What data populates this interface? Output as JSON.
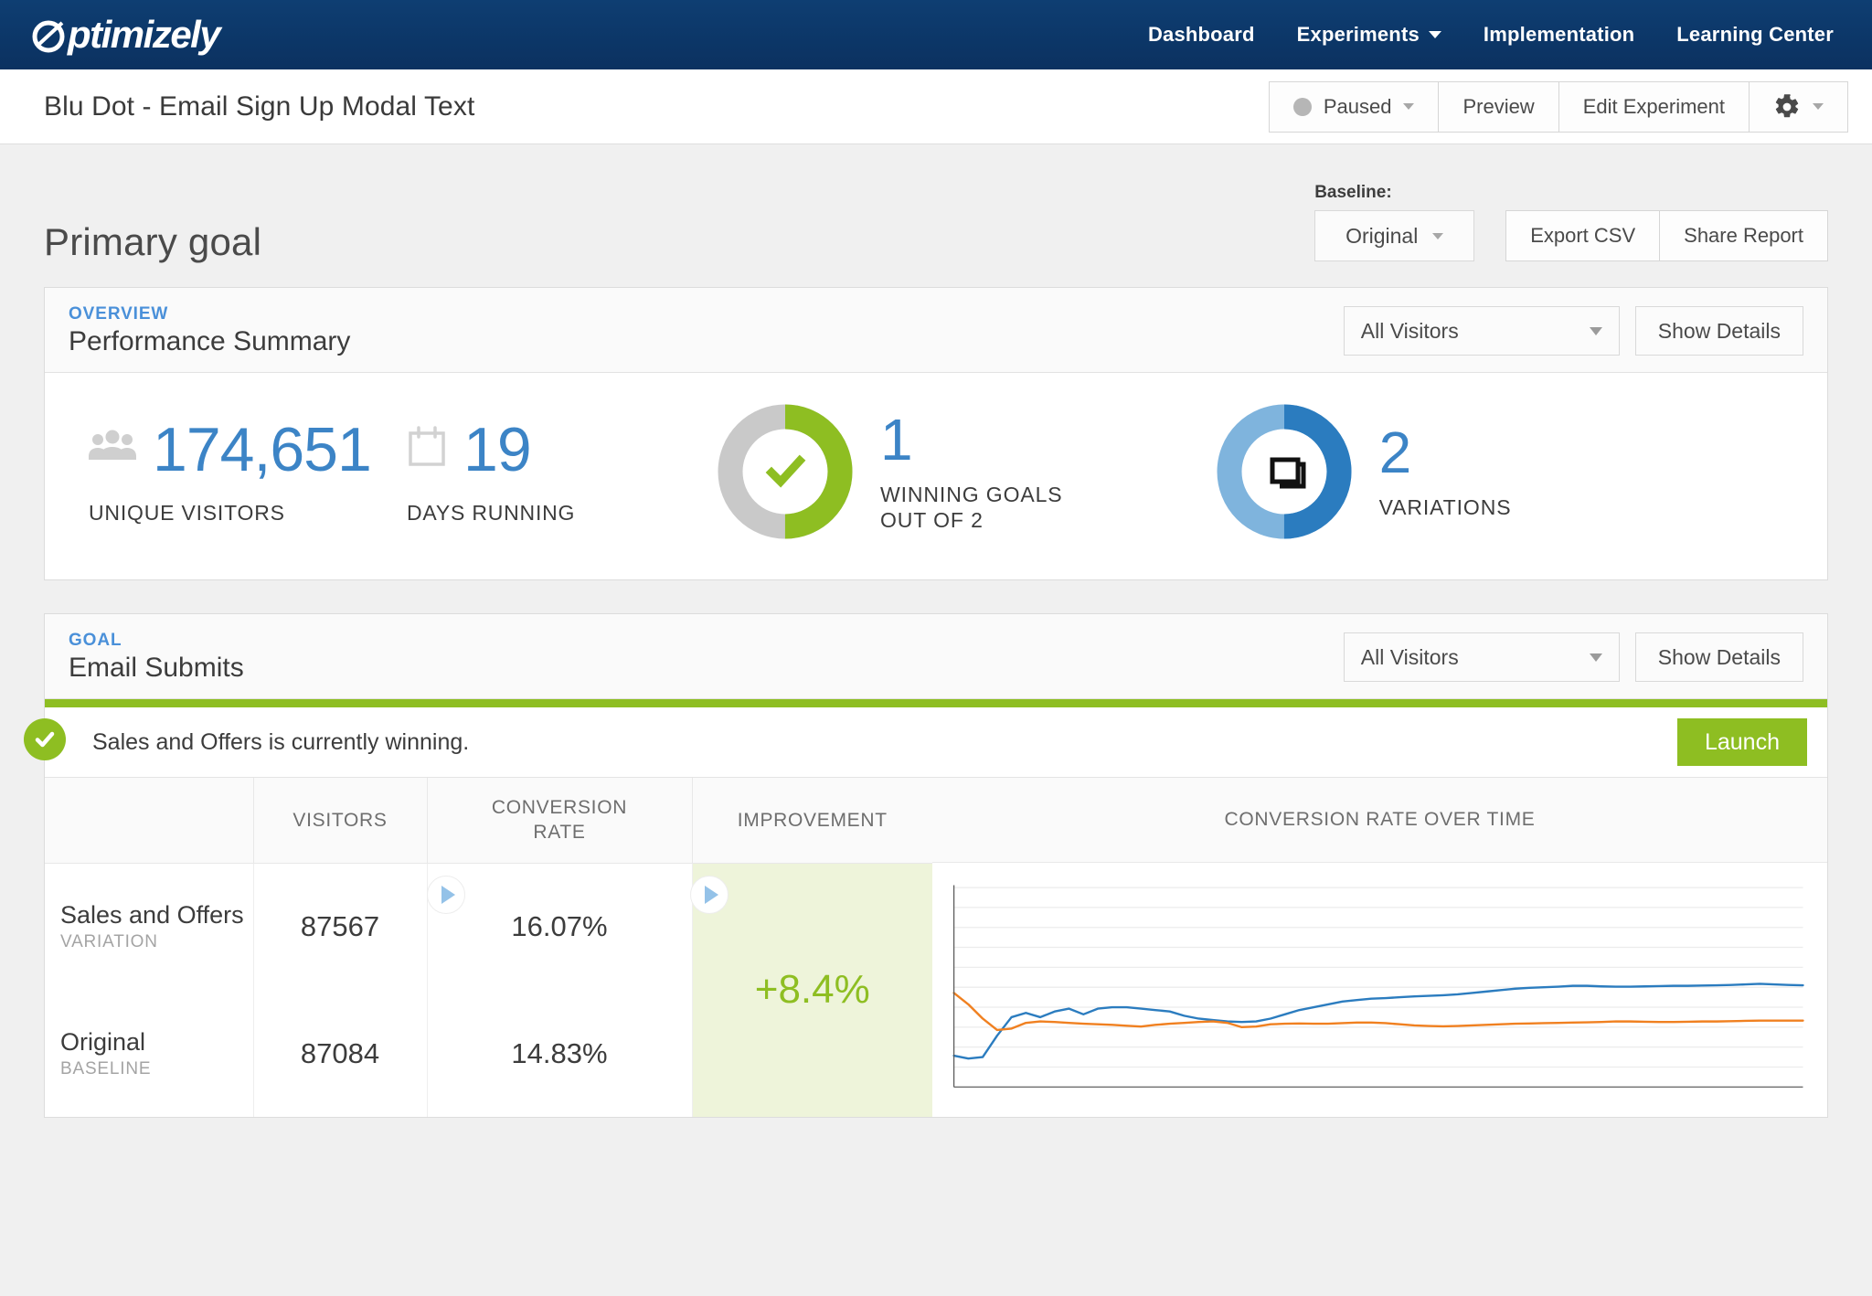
{
  "brand": {
    "logo_text": "ptimizely",
    "nav_bg": "#0d3c6e",
    "accent_blue": "#3c84c6",
    "accent_green": "#8ebe22"
  },
  "topnav": {
    "items": [
      {
        "label": "Dashboard",
        "has_caret": false
      },
      {
        "label": "Experiments",
        "has_caret": true
      },
      {
        "label": "Implementation",
        "has_caret": false
      },
      {
        "label": "Learning Center",
        "has_caret": false
      }
    ]
  },
  "titlebar": {
    "experiment_name": "Blu Dot - Email Sign Up Modal Text",
    "status_label": "Paused",
    "preview_label": "Preview",
    "edit_label": "Edit Experiment"
  },
  "page": {
    "title": "Primary goal",
    "baseline_label": "Baseline:",
    "baseline_value": "Original",
    "export_label": "Export CSV",
    "share_label": "Share Report"
  },
  "overview": {
    "kicker": "OVERVIEW",
    "title": "Performance Summary",
    "filter_value": "All Visitors",
    "details_label": "Show Details",
    "stats": {
      "unique_visitors_value": "174,651",
      "unique_visitors_label": "UNIQUE VISITORS",
      "days_running_value": "19",
      "days_running_label": "DAYS RUNNING",
      "winning_goals_value": "1",
      "winning_goals_label_line1": "WINNING GOALS",
      "winning_goals_label_line2": "OUT OF 2",
      "variations_value": "2",
      "variations_label": "VARIATIONS"
    }
  },
  "goal": {
    "kicker": "GOAL",
    "title": "Email Submits",
    "filter_value": "All Visitors",
    "details_label": "Show Details",
    "winning_message": "Sales and Offers is currently winning.",
    "launch_label": "Launch",
    "columns": {
      "name": "",
      "visitors": "VISITORS",
      "rate_line1": "CONVERSION",
      "rate_line2": "RATE",
      "improvement": "IMPROVEMENT",
      "chart": "CONVERSION RATE OVER TIME"
    },
    "rows": [
      {
        "name": "Sales and Offers",
        "type": "VARIATION",
        "visitors": "87567",
        "conversion_rate": "16.07%",
        "improvement": "+8.4%"
      },
      {
        "name": "Original",
        "type": "BASELINE",
        "visitors": "87084",
        "conversion_rate": "14.83%",
        "improvement": ""
      }
    ]
  },
  "chart_data": {
    "type": "line",
    "title": "CONVERSION RATE OVER TIME",
    "xlabel": "",
    "ylabel": "",
    "ylim": [
      12.5,
      19.5
    ],
    "grid": true,
    "legend": "none",
    "x": [
      0,
      1,
      2,
      3,
      4,
      5,
      6,
      7,
      8,
      9,
      10,
      11,
      12,
      13,
      14,
      15,
      16,
      17,
      18,
      19,
      20,
      21,
      22,
      23,
      24,
      25,
      26,
      27,
      28,
      29,
      30,
      31,
      32,
      33,
      34,
      35,
      36,
      37,
      38,
      39,
      40,
      41,
      42,
      43,
      44,
      45,
      46,
      47,
      48,
      49,
      50,
      51,
      52,
      53,
      54,
      55,
      56,
      57,
      58,
      59
    ],
    "series": [
      {
        "name": "Sales and Offers",
        "color": "#2b7cbf",
        "values": [
          13.6,
          13.5,
          13.55,
          14.3,
          14.95,
          15.1,
          14.95,
          15.15,
          15.25,
          15.05,
          15.25,
          15.3,
          15.3,
          15.25,
          15.2,
          15.15,
          15.0,
          14.9,
          14.85,
          14.8,
          14.78,
          14.8,
          14.9,
          15.05,
          15.2,
          15.3,
          15.4,
          15.5,
          15.55,
          15.6,
          15.62,
          15.65,
          15.68,
          15.7,
          15.72,
          15.75,
          15.8,
          15.85,
          15.9,
          15.95,
          15.98,
          16.0,
          16.02,
          16.05,
          16.05,
          16.03,
          16.02,
          16.02,
          16.03,
          16.04,
          16.05,
          16.05,
          16.06,
          16.07,
          16.08,
          16.1,
          16.12,
          16.1,
          16.08,
          16.07
        ]
      },
      {
        "name": "Original",
        "color": "#f08020",
        "values": [
          15.8,
          15.4,
          14.9,
          14.5,
          14.55,
          14.75,
          14.8,
          14.78,
          14.75,
          14.72,
          14.7,
          14.68,
          14.65,
          14.62,
          14.68,
          14.72,
          14.75,
          14.78,
          14.8,
          14.75,
          14.6,
          14.62,
          14.7,
          14.72,
          14.73,
          14.72,
          14.72,
          14.74,
          14.76,
          14.76,
          14.74,
          14.7,
          14.66,
          14.64,
          14.63,
          14.64,
          14.66,
          14.68,
          14.7,
          14.72,
          14.73,
          14.74,
          14.75,
          14.76,
          14.77,
          14.78,
          14.8,
          14.8,
          14.79,
          14.78,
          14.78,
          14.79,
          14.8,
          14.8,
          14.81,
          14.82,
          14.83,
          14.83,
          14.83,
          14.83
        ]
      }
    ]
  }
}
